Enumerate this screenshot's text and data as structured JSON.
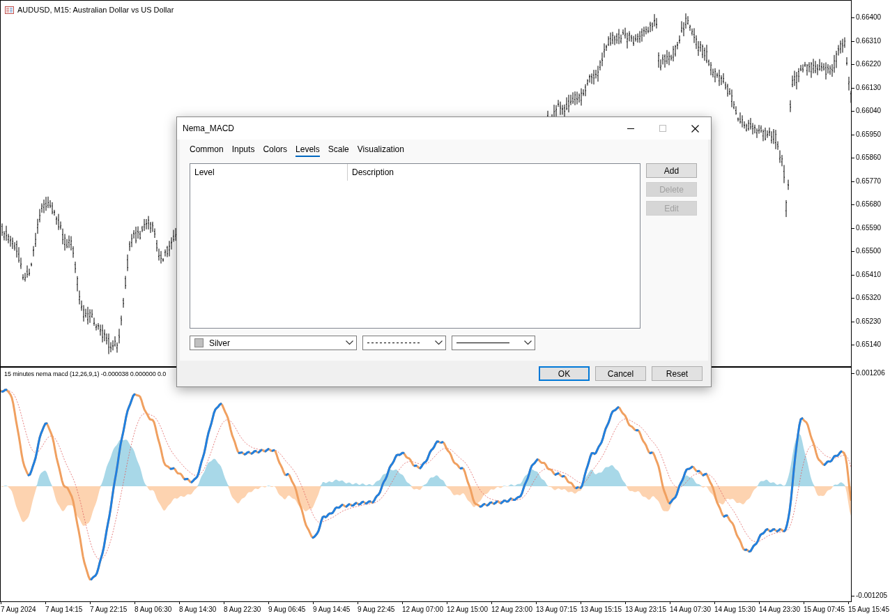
{
  "chart": {
    "title": "AUDUSD, M15:  Australian Dollar vs US Dollar",
    "price_axis": [
      "0.66400",
      "0.66310",
      "0.66220",
      "0.66130",
      "0.66040",
      "0.65950",
      "0.65860",
      "0.65770",
      "0.65680",
      "0.65590",
      "0.65500",
      "0.65410",
      "0.65320",
      "0.65230",
      "0.65140"
    ],
    "indicator": {
      "label": "15 minutes nema macd (12,26,9,1) -0.000038 0.000000 0.0",
      "axis_labels": [
        "0.001206",
        "-0.001205"
      ]
    },
    "time_axis": [
      "7 Aug 2024",
      "7 Aug 14:15",
      "7 Aug 22:15",
      "8 Aug 06:30",
      "8 Aug 14:30",
      "8 Aug 22:30",
      "9 Aug 06:45",
      "9 Aug 14:45",
      "9 Aug 22:45",
      "12 Aug 07:00",
      "12 Aug 15:00",
      "12 Aug 23:00",
      "13 Aug 07:15",
      "13 Aug 15:15",
      "13 Aug 23:15",
      "14 Aug 07:30",
      "14 Aug 15:30",
      "14 Aug 23:30",
      "15 Aug 07:45",
      "15 Aug 15:45"
    ]
  },
  "dialog": {
    "title": "Nema_MACD",
    "tabs": [
      {
        "label": "Common",
        "selected": false
      },
      {
        "label": "Inputs",
        "selected": false
      },
      {
        "label": "Colors",
        "selected": false
      },
      {
        "label": "Levels",
        "selected": true
      },
      {
        "label": "Scale",
        "selected": false
      },
      {
        "label": "Visualization",
        "selected": false
      }
    ],
    "table": {
      "columns": [
        "Level",
        "Description"
      ]
    },
    "side_buttons": [
      {
        "label": "Add",
        "disabled": false
      },
      {
        "label": "Delete",
        "disabled": true
      },
      {
        "label": "Edit",
        "disabled": true
      }
    ],
    "color_select": {
      "value": "Silver",
      "color": "#c0c0c0"
    },
    "style_select": {
      "kind": "dashed"
    },
    "width_select": {
      "kind": "solid"
    },
    "buttons": [
      {
        "label": "OK",
        "default": true
      },
      {
        "label": "Cancel",
        "default": false
      },
      {
        "label": "Reset",
        "default": false
      }
    ]
  }
}
